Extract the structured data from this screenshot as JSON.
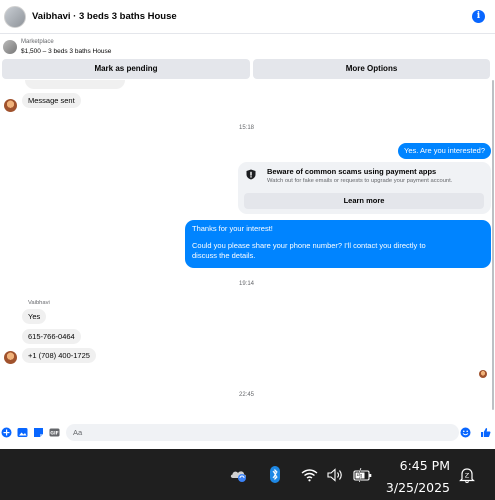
{
  "header": {
    "title": "Vaibhavi · 3 beds 3 baths House",
    "info_icon": "i"
  },
  "listing": {
    "source": "Marketplace",
    "description": "$1,500 – 3 beds 3 baths House"
  },
  "actions": {
    "mark_pending": "Mark as pending",
    "more_options": "More Options"
  },
  "messages": {
    "sent_status": "Message sent",
    "timestamp_1": "15:18",
    "outgoing_question": "Yes. Are you interested?",
    "warning_title": "Beware of common scams using payment apps",
    "warning_subtitle": "Watch out for fake emails or requests to upgrade your payment account.",
    "learn_more": "Learn more",
    "thanks_line1": "Thanks for your interest!",
    "thanks_line2": "Could you please share your phone number? I'll contact you directly to",
    "thanks_line3": "discuss the details.",
    "timestamp_2": "19:14",
    "sender_name": "Vaibhavi",
    "reply_yes": "Yes",
    "reply_phone1": "615-766-0464",
    "reply_phone2": "+1 (708) 400-1725",
    "timestamp_3": "22:45"
  },
  "composer": {
    "placeholder": "Aa"
  },
  "taskbar": {
    "time": "6:45 PM",
    "date": "3/25/2025"
  },
  "colors": {
    "accent": "#0084ff",
    "link_blue": "#0866ff",
    "taskbar": "#1f1f1f"
  }
}
